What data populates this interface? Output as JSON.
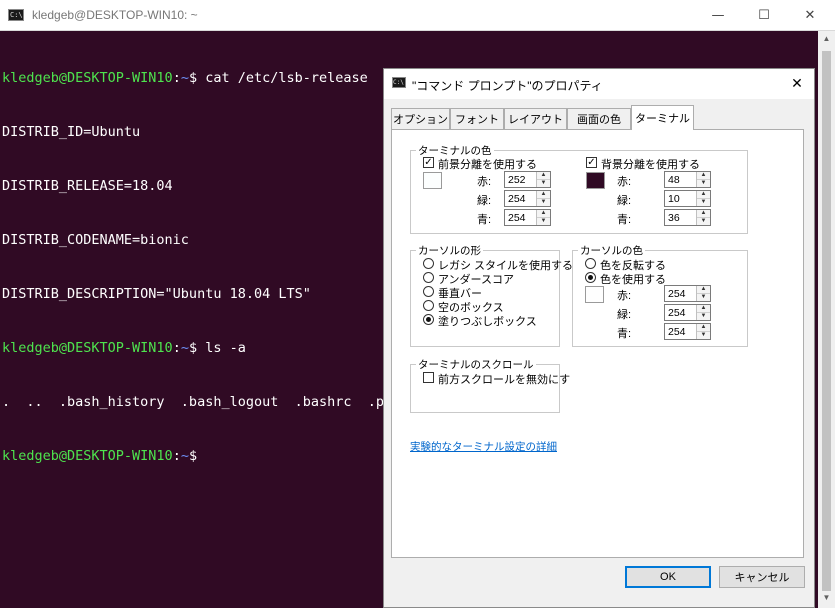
{
  "terminal": {
    "title": "kledgeb@DESKTOP-WIN10: ~",
    "icon": "console-icon",
    "lines": [
      {
        "user": "kledgeb@DESKTOP-WIN10",
        "path": "~",
        "cmd": "$ cat /etc/lsb-release"
      },
      {
        "text": "DISTRIB_ID=Ubuntu"
      },
      {
        "text": "DISTRIB_RELEASE=18.04"
      },
      {
        "text": "DISTRIB_CODENAME=bionic"
      },
      {
        "text": "DISTRIB_DESCRIPTION=\"Ubuntu 18.04 LTS\""
      },
      {
        "user": "kledgeb@DESKTOP-WIN10",
        "path": "~",
        "cmd": "$ ls -a"
      },
      {
        "text": ".  ..  .bash_history  .bash_logout  .bashrc  .pr"
      },
      {
        "user": "kledgeb@DESKTOP-WIN10",
        "path": "~",
        "cmd": "$"
      }
    ],
    "colors": {
      "background": "#300a24",
      "user": "#4ee44e",
      "path": "#6d8ef5",
      "text": "#ffffff"
    }
  },
  "window_controls": {
    "minimize": "—",
    "maximize": "☐",
    "close": "✕"
  },
  "dialog": {
    "title": "\"コマンド プロンプト\"のプロパティ",
    "close": "✕",
    "tabs": [
      "オプション",
      "フォント",
      "レイアウト",
      "画面の色",
      "ターミナル"
    ],
    "active_tab": "ターミナル",
    "terminal_colors": {
      "label": "ターミナルの色",
      "foreground": {
        "checkbox": "前景分離を使用する",
        "checked": true,
        "swatch": "#fcfefe",
        "red_label": "赤:",
        "green_label": "緑:",
        "blue_label": "青:",
        "red": "252",
        "green": "254",
        "blue": "254"
      },
      "background": {
        "checkbox": "背景分離を使用する",
        "checked": true,
        "swatch": "#300a24",
        "red_label": "赤:",
        "green_label": "緑:",
        "blue_label": "青:",
        "red": "48",
        "green": "10",
        "blue": "36"
      }
    },
    "cursor_shape": {
      "label": "カーソルの形",
      "options": [
        "レガシ スタイルを使用する",
        "アンダースコア",
        "垂直バー",
        "空のボックス",
        "塗りつぶしボックス"
      ],
      "selected": 4
    },
    "cursor_color": {
      "label": "カーソルの色",
      "options": [
        "色を反転する",
        "色を使用する"
      ],
      "selected": 1,
      "swatch": "#fefefe",
      "red_label": "赤:",
      "green_label": "緑:",
      "blue_label": "青:",
      "red": "254",
      "green": "254",
      "blue": "254"
    },
    "terminal_scroll": {
      "label": "ターミナルのスクロール",
      "checkbox": "前方スクロールを無効にす",
      "checked": false
    },
    "link": "実験的なターミナル設定の詳細",
    "ok": "OK",
    "cancel": "キャンセル"
  }
}
